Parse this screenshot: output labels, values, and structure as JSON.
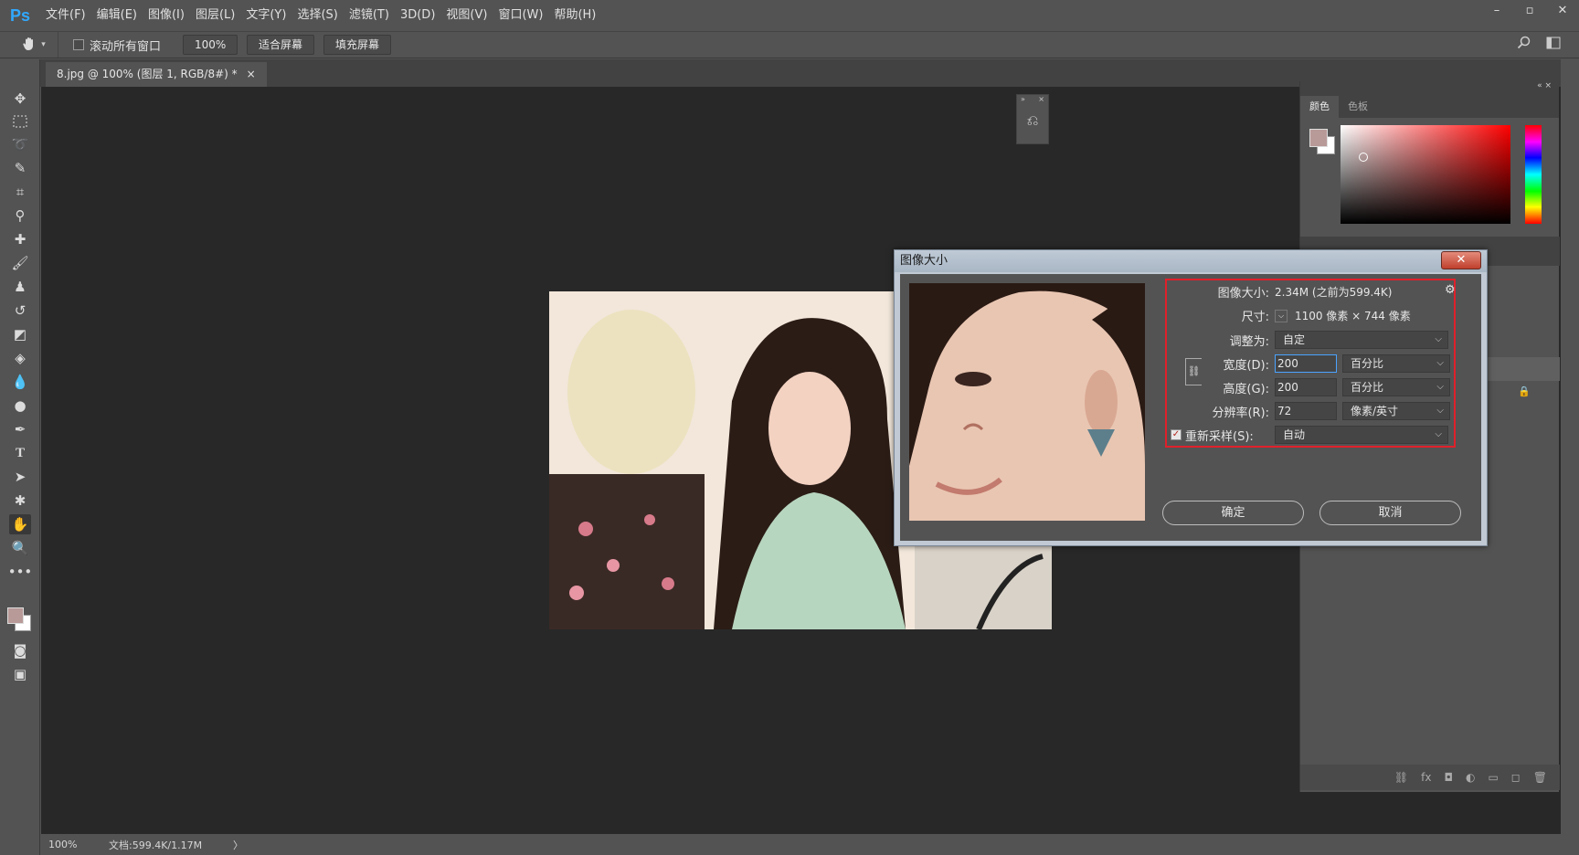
{
  "app": {
    "logo": "Ps"
  },
  "menu": [
    "文件(F)",
    "编辑(E)",
    "图像(I)",
    "图层(L)",
    "文字(Y)",
    "选择(S)",
    "滤镜(T)",
    "3D(D)",
    "视图(V)",
    "窗口(W)",
    "帮助(H)"
  ],
  "window_controls": {
    "minimize": "–",
    "maximize": "▫",
    "close": "✕"
  },
  "options": {
    "scroll_all_label": "滚动所有窗口",
    "zoom_value": "100%",
    "fit_screen_label": "适合屏幕",
    "fill_screen_label": "填充屏幕"
  },
  "document_tab": {
    "title": "8.jpg @ 100% (图层 1, RGB/8#) *",
    "close": "×"
  },
  "status": {
    "zoom": "100%",
    "doc_info": "文档:599.4K/1.17M",
    "arrow": "〉"
  },
  "color_panel": {
    "tabs": [
      "颜色",
      "色板"
    ],
    "fg_color": "#b89a98",
    "bg_color": "#ffffff"
  },
  "dialog": {
    "title": "图像大小",
    "close_glyph": "✕",
    "image_size_label": "图像大小:",
    "image_size_value": "2.34M (之前为599.4K)",
    "dimensions_label": "尺寸:",
    "dimensions_value": "1100 像素  ×  744 像素",
    "fit_to_label": "调整为:",
    "fit_to_value": "自定",
    "width_label": "宽度(D):",
    "width_value": "200",
    "width_unit": "百分比",
    "height_label": "高度(G):",
    "height_value": "200",
    "height_unit": "百分比",
    "resolution_label": "分辨率(R):",
    "resolution_value": "72",
    "resolution_unit": "像素/英寸",
    "resample_label": "重新采样(S):",
    "resample_value": "自动",
    "ok_label": "确定",
    "cancel_label": "取消"
  }
}
